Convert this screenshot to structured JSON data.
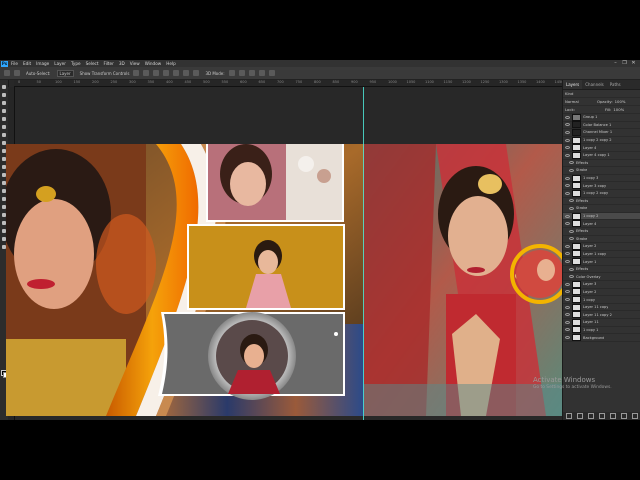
{
  "menubar": {
    "logo": "Ps",
    "items": [
      "File",
      "Edit",
      "Image",
      "Layer",
      "Type",
      "Select",
      "Filter",
      "3D",
      "View",
      "Window",
      "Help"
    ],
    "window_controls": [
      "–",
      "❐",
      "✕"
    ]
  },
  "options_bar": {
    "auto_select_label": "Auto-Select:",
    "auto_select_value": "Layer",
    "show_transform_label": "Show Transform Controls",
    "mode_3d_label": "3D Mode:"
  },
  "ruler_ticks": [
    "0",
    "50",
    "100",
    "150",
    "200",
    "250",
    "300",
    "350",
    "400",
    "450",
    "500",
    "550",
    "600",
    "650",
    "700",
    "750",
    "800",
    "850",
    "900",
    "950",
    "1000",
    "1050",
    "1100",
    "1150",
    "1200",
    "1250",
    "1300",
    "1350",
    "1400",
    "1450"
  ],
  "layers_panel": {
    "tabs": [
      "Layers",
      "Channels",
      "Paths"
    ],
    "kind_label": "Kind",
    "blend_mode": "Normal",
    "opacity_label": "Opacity:",
    "opacity_value": "100%",
    "lock_label": "Lock:",
    "fill_label": "Fill:",
    "fill_value": "100%",
    "layers": [
      {
        "name": "Group 1",
        "type": "group",
        "selected": false,
        "sub": false
      },
      {
        "name": "Color Balance 1",
        "type": "adj",
        "selected": false,
        "sub": false
      },
      {
        "name": "Channel Mixer 1",
        "type": "adj",
        "selected": false,
        "sub": false
      },
      {
        "name": "1 copy 2 copy 2",
        "type": "img",
        "selected": false,
        "sub": false
      },
      {
        "name": "Layer 4",
        "type": "img",
        "selected": false,
        "sub": false
      },
      {
        "name": "Layer 4 copy 1",
        "type": "img",
        "selected": false,
        "sub": false
      },
      {
        "name": "Effects",
        "type": "fx",
        "selected": false,
        "sub": true
      },
      {
        "name": "Stroke",
        "type": "fx",
        "selected": false,
        "sub": true
      },
      {
        "name": "1 copy 3",
        "type": "img",
        "selected": false,
        "sub": false
      },
      {
        "name": "Layer 3 copy",
        "type": "img",
        "selected": false,
        "sub": false
      },
      {
        "name": "1 copy 2 copy",
        "type": "img",
        "selected": false,
        "sub": false
      },
      {
        "name": "Effects",
        "type": "fx",
        "selected": false,
        "sub": true
      },
      {
        "name": "Stroke",
        "type": "fx",
        "selected": false,
        "sub": true
      },
      {
        "name": "1 copy 2",
        "type": "img",
        "selected": true,
        "sub": false
      },
      {
        "name": "Layer 4",
        "type": "img",
        "selected": false,
        "sub": false
      },
      {
        "name": "Effects",
        "type": "fx",
        "selected": false,
        "sub": true
      },
      {
        "name": "Stroke",
        "type": "fx",
        "selected": false,
        "sub": true
      },
      {
        "name": "Layer 2",
        "type": "img",
        "selected": false,
        "sub": false
      },
      {
        "name": "Layer 1 copy",
        "type": "img",
        "selected": false,
        "sub": false
      },
      {
        "name": "Layer 1",
        "type": "img",
        "selected": false,
        "sub": false
      },
      {
        "name": "Effects",
        "type": "fx",
        "selected": false,
        "sub": true
      },
      {
        "name": "Color Overlay",
        "type": "fx",
        "selected": false,
        "sub": true
      },
      {
        "name": "Layer 3",
        "type": "img",
        "selected": false,
        "sub": false
      },
      {
        "name": "Layer 2",
        "type": "img",
        "selected": false,
        "sub": false
      },
      {
        "name": "1 copy",
        "type": "img",
        "selected": false,
        "sub": false
      },
      {
        "name": "Layer 11 copy",
        "type": "img",
        "selected": false,
        "sub": false
      },
      {
        "name": "Layer 11 copy 2",
        "type": "img",
        "selected": false,
        "sub": false
      },
      {
        "name": "Layer 11",
        "type": "img",
        "selected": false,
        "sub": false
      },
      {
        "name": "1 copy 1",
        "type": "img",
        "selected": false,
        "sub": false
      },
      {
        "name": "Background",
        "type": "img",
        "selected": false,
        "sub": false
      }
    ]
  },
  "watermark": {
    "title": "Activate Windows",
    "subtitle": "Go to Settings to activate Windows."
  },
  "colors": {
    "ui_dark": "#282828",
    "panel": "#323232",
    "accent_orange": "#f08a00",
    "guide": "#4ff0e0",
    "ring_yellow": "#f3b400"
  }
}
